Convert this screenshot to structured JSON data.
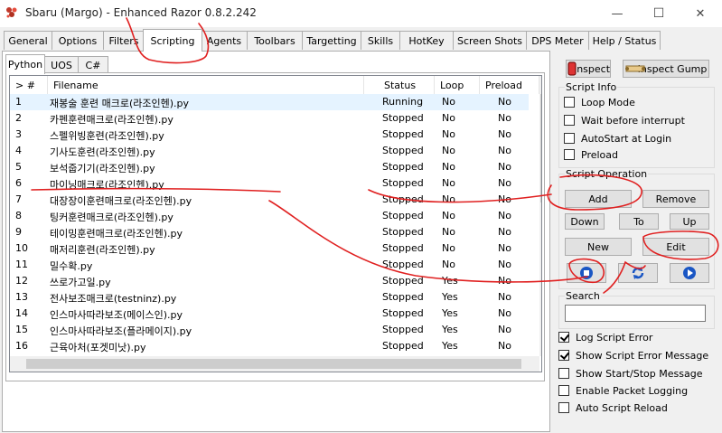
{
  "window": {
    "title": "Sbaru (Margo) - Enhanced Razor 0.8.2.242",
    "minimize_glyph": "—",
    "maximize_glyph": "☐",
    "close_glyph": "✕"
  },
  "main_tabs": [
    "General",
    "Options",
    "Filters",
    "Scripting",
    "Agents",
    "Toolbars",
    "Targetting",
    "Skills",
    "HotKey",
    "Screen Shots",
    "DPS Meter",
    "Help / Status"
  ],
  "sub_tabs": [
    "Python",
    "UOS",
    "C#"
  ],
  "list": {
    "headers": {
      "num": "> #",
      "filename": "Filename",
      "status": "Status",
      "loop": "Loop",
      "preload": "Preload"
    },
    "rows": [
      {
        "num": "1",
        "filename": "재봉술 훈련 매크로(라조인헨).py",
        "status": "Running",
        "loop": "No",
        "preload": "No"
      },
      {
        "num": "2",
        "filename": "카펜훈련매크로(라조인헨).py",
        "status": "Stopped",
        "loop": "No",
        "preload": "No"
      },
      {
        "num": "3",
        "filename": "스펠위빙훈련(라조인헨).py",
        "status": "Stopped",
        "loop": "No",
        "preload": "No"
      },
      {
        "num": "4",
        "filename": "기사도훈련(라조인헨).py",
        "status": "Stopped",
        "loop": "No",
        "preload": "No"
      },
      {
        "num": "5",
        "filename": "보석줍기기(라조인헨).py",
        "status": "Stopped",
        "loop": "No",
        "preload": "No"
      },
      {
        "num": "6",
        "filename": "마이닝매크로(라조인헨).py",
        "status": "Stopped",
        "loop": "No",
        "preload": "No"
      },
      {
        "num": "7",
        "filename": "대장장이훈련매크로(라조인헨).py",
        "status": "Stopped",
        "loop": "No",
        "preload": "No"
      },
      {
        "num": "8",
        "filename": "팅커훈련매크로(라조인헨).py",
        "status": "Stopped",
        "loop": "No",
        "preload": "No"
      },
      {
        "num": "9",
        "filename": "테이밍훈련매크로(라조인헨).py",
        "status": "Stopped",
        "loop": "No",
        "preload": "No"
      },
      {
        "num": "10",
        "filename": "매저리훈련(라조인헨).py",
        "status": "Stopped",
        "loop": "No",
        "preload": "No"
      },
      {
        "num": "11",
        "filename": "밀수확.py",
        "status": "Stopped",
        "loop": "No",
        "preload": "No"
      },
      {
        "num": "12",
        "filename": "쓰로가고일.py",
        "status": "Stopped",
        "loop": "Yes",
        "preload": "No"
      },
      {
        "num": "13",
        "filename": "전사보조매크로(testninz).py",
        "status": "Stopped",
        "loop": "Yes",
        "preload": "No"
      },
      {
        "num": "14",
        "filename": "인스마사따라보조(메이스인).py",
        "status": "Stopped",
        "loop": "Yes",
        "preload": "No"
      },
      {
        "num": "15",
        "filename": "인스마사따라보조(플라메이지).py",
        "status": "Stopped",
        "loop": "Yes",
        "preload": "No"
      },
      {
        "num": "16",
        "filename": "근육아처(포겟미낫).py",
        "status": "Stopped",
        "loop": "Yes",
        "preload": "No"
      }
    ]
  },
  "right": {
    "inspect_label": "Inspect",
    "inspect_gump_label": "Inspect Gump",
    "script_info_label": "Script Info",
    "loop_mode": "Loop Mode",
    "wait_before_interrupt": "Wait before interrupt",
    "autostart": "AutoStart at Login",
    "preload": "Preload",
    "script_operation_label": "Script Operation",
    "add": "Add",
    "remove": "Remove",
    "down": "Down",
    "to": "To",
    "up": "Up",
    "new": "New",
    "edit": "Edit",
    "search_label": "Search",
    "search_value": "",
    "log_script_error": "Log Script Error",
    "show_script_error_message": "Show Script Error Message",
    "show_start_stop_message": "Show Start/Stop Message",
    "enable_packet_logging": "Enable Packet Logging",
    "auto_script_reload": "Auto Script Reload"
  },
  "colors": {
    "annotation": "#e02020",
    "selected_row": "#e5f3ff",
    "play_blue": "#1a56c4"
  }
}
